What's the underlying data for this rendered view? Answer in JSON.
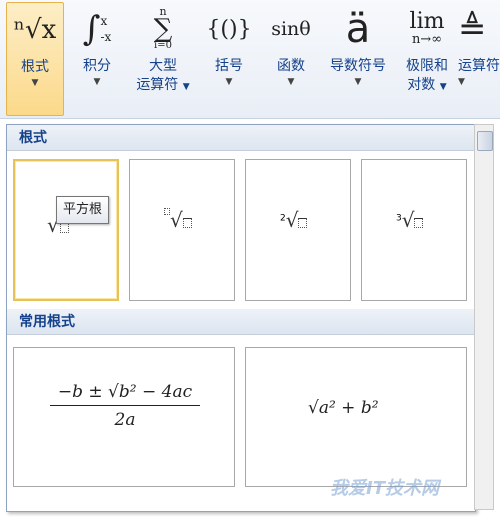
{
  "ribbon": {
    "buttons": [
      {
        "glyph": "ⁿ√x",
        "label": "根式"
      },
      {
        "glyph": "∫",
        "label": "积分"
      },
      {
        "glyph": "∑",
        "label1": "大型",
        "label2": "运算符"
      },
      {
        "glyph": "{()}",
        "label": "括号"
      },
      {
        "glyph": "sinθ",
        "label": "函数"
      },
      {
        "glyph": "ä",
        "label": "导数符号"
      },
      {
        "glyph": "lim",
        "sub": "n→∞",
        "label1": "极限和",
        "label2": "对数"
      },
      {
        "glyph": "≜",
        "label": "运算符"
      }
    ]
  },
  "panel": {
    "section1": "根式",
    "section2": "常用根式",
    "tooltip": "平方根",
    "radical_indices": [
      "",
      "□",
      "2",
      "3"
    ],
    "formula1": {
      "numerator": "−b ± √b² − 4ac",
      "denominator": "2a"
    },
    "formula2": "√a² + b²"
  },
  "watermark": "我爱IT技术网"
}
